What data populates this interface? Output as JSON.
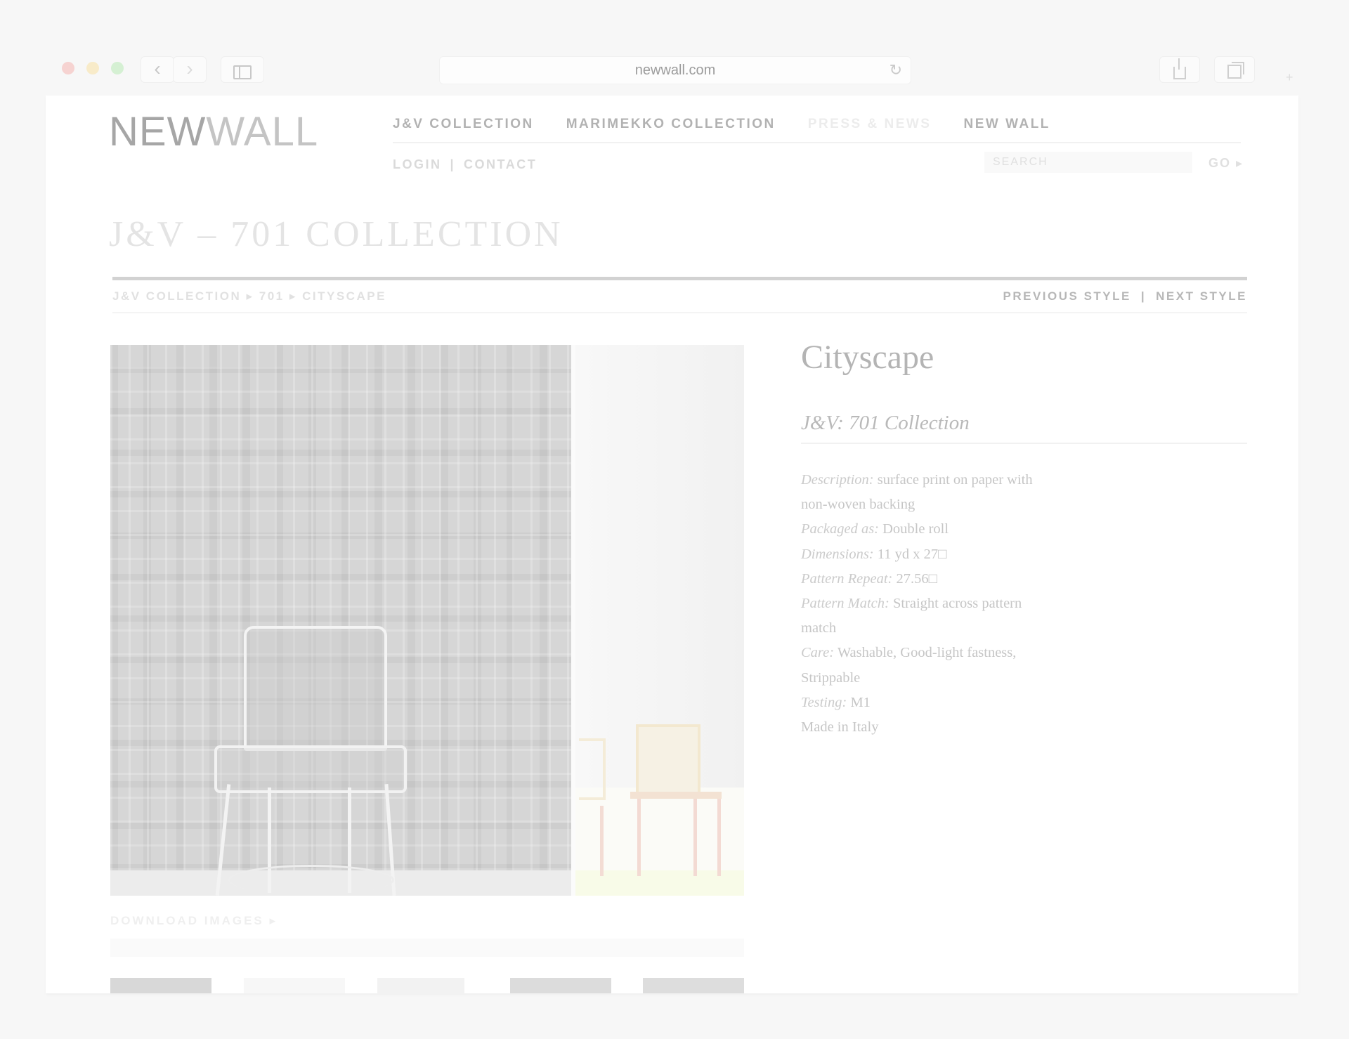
{
  "browser": {
    "url": "newwall.com",
    "icons": [
      "back-icon",
      "forward-icon",
      "sidebar-icon",
      "reload-icon",
      "share-icon",
      "tabs-icon",
      "new-tab-icon"
    ]
  },
  "header": {
    "logo": {
      "part1": "NEW",
      "part2": "WALL"
    },
    "nav": [
      {
        "label": "J&V COLLECTION"
      },
      {
        "label": "MARIMEKKO COLLECTION"
      },
      {
        "label": "PRESS & NEWS"
      },
      {
        "label": "NEW WALL"
      }
    ],
    "sub_nav": {
      "login": "LOGIN",
      "separator": "|",
      "contact": "CONTACT"
    },
    "search": {
      "placeholder": "SEARCH",
      "value": "",
      "go_label": "GO ▸"
    }
  },
  "page_title": "J&V – 701 COLLECTION",
  "breadcrumb": "J&V COLLECTION ▸ 701 ▸ CITYSCAPE",
  "style_nav": {
    "previous": "PREVIOUS STYLE",
    "separator": "|",
    "next": "NEXT STYLE"
  },
  "product": {
    "name": "Cityscape",
    "collection": "J&V: 701 Collection",
    "details": [
      {
        "label": "Description:",
        "value": "surface print on paper with non-woven backing"
      },
      {
        "label": "Packaged as:",
        "value": "Double roll"
      },
      {
        "label": "Dimensions:",
        "value": "11 yd x 27□"
      },
      {
        "label": "Pattern Repeat:",
        "value": "27.56□"
      },
      {
        "label": "Pattern Match:",
        "value": "Straight across pattern match"
      },
      {
        "label": "Care:",
        "value": "Washable, Good-light fastness, Strippable"
      },
      {
        "label": "Testing:",
        "value": "M1"
      },
      {
        "label": "",
        "value": "Made in Italy"
      }
    ]
  },
  "downloads": {
    "label": "DOWNLOAD IMAGES ▸"
  },
  "colors": {
    "background": "#f7f7f7",
    "page": "#ffffff",
    "text_faded": "#bdbdbd",
    "rule": "#d2d2d2"
  }
}
